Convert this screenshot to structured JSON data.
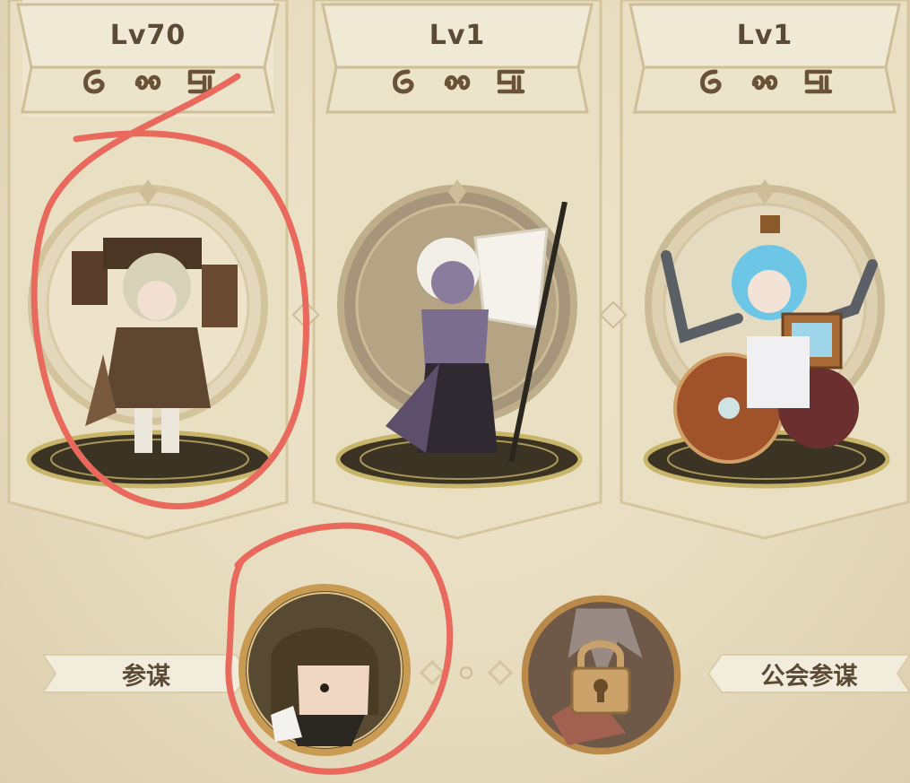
{
  "cards": [
    {
      "level": "Lv70",
      "hero_icon": "hero-sprite-gunner"
    },
    {
      "level": "Lv1",
      "hero_icon": "hero-sprite-dark-elf-lancer"
    },
    {
      "level": "Lv1",
      "hero_icon": "hero-sprite-wheelchair-robot-arms"
    }
  ],
  "runes": [
    "rune-1-icon",
    "rune-2-icon",
    "rune-3-icon"
  ],
  "bottom": {
    "left_label": "参谋",
    "right_label": "公会参谋",
    "advisor_icon": "advisor-portrait",
    "locked_icon": "lock-icon"
  },
  "colors": {
    "text_brown": "#5b4a36",
    "annotation_red": "#e96a5c",
    "gold_ring": "#c89a52"
  }
}
